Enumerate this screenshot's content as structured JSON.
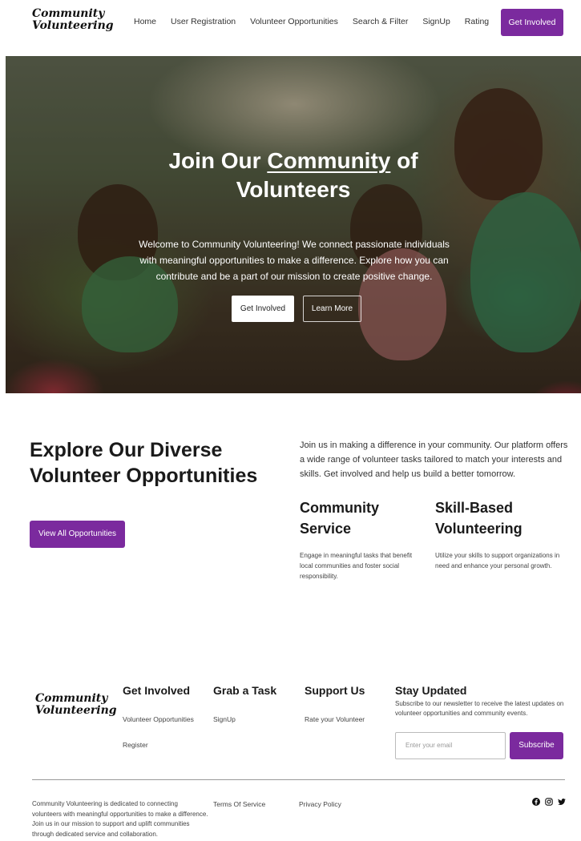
{
  "brand": {
    "name_line1": "Community",
    "name_line2": "Volunteering"
  },
  "nav": {
    "links": [
      "Home",
      "User Registration",
      "Volunteer Opportunities",
      "Search & Filter",
      "SignUp",
      "Rating"
    ],
    "cta": "Get Involved"
  },
  "hero": {
    "title_part1": "Join Our ",
    "title_underlined": "Community",
    "title_part2": " of",
    "title_line2": "Volunteers",
    "text": "Welcome to Community Volunteering! We connect passionate individuals with meaningful opportunities to make a difference. Explore how you can contribute and be a part of our mission to create positive change.",
    "primary_button": "Get Involved",
    "secondary_button": "Learn More"
  },
  "explore": {
    "title": "Explore Our Diverse Volunteer Opportunities",
    "button": "View All Opportunities",
    "intro": "Join us in making a difference in your community. Our platform offers a wide range of volunteer tasks tailored to match your interests and skills. Get involved and help us build a better tomorrow.",
    "cards": [
      {
        "title": "Community Service",
        "text": "Engage in meaningful tasks that benefit local communities and foster social responsibility."
      },
      {
        "title": "Skill-Based Volunteering",
        "text": "Utilize your skills to support organizations in need and enhance your personal growth."
      }
    ]
  },
  "footer": {
    "col1": {
      "heading": "Get Involved",
      "links": [
        "Volunteer Opportunities",
        "Register"
      ]
    },
    "col2": {
      "heading": "Grab a Task",
      "links": [
        "SignUp"
      ]
    },
    "col3": {
      "heading": "Support Us",
      "links": [
        "Rate your Volunteer"
      ]
    },
    "stay": {
      "heading": "Stay Updated",
      "text": "Subscribe to our newsletter to receive the latest updates on volunteer opportunities and community events.",
      "email_placeholder": "Enter your email",
      "button": "Subscribe"
    },
    "about": "Community Volunteering is dedicated to connecting volunteers with meaningful opportunities to make a difference. Join us in our mission to support and uplift communities through dedicated service and collaboration.",
    "terms": "Terms Of Service",
    "privacy": "Privacy Policy",
    "social_icons": [
      "facebook-icon",
      "instagram-icon",
      "twitter-icon"
    ]
  },
  "colors": {
    "accent": "#7b2a9e"
  }
}
